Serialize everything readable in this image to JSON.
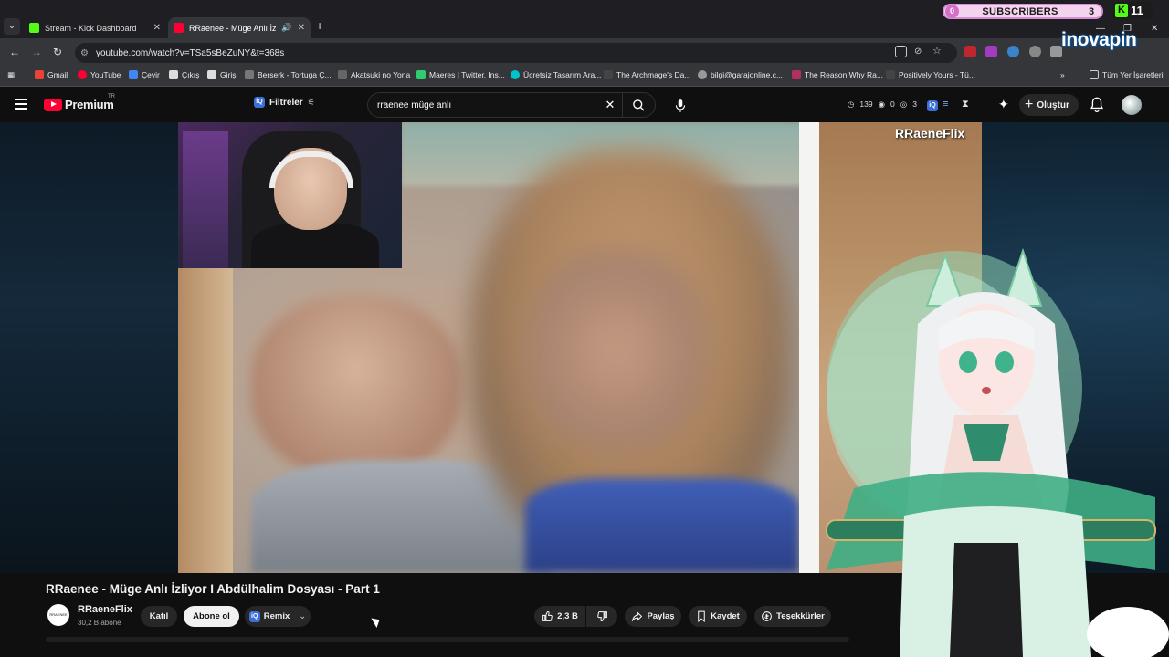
{
  "browser": {
    "tabs": [
      {
        "title": "Stream - Kick Dashboard",
        "active": false,
        "favicon_color": "#53fc18"
      },
      {
        "title": "RRaenee - Müge Anlı İzliyor",
        "active": true,
        "favicon_color": "#ff0033"
      }
    ],
    "url": "youtube.com/watch?v=TSa5sBeZuNY&t=368s",
    "bookmarks": [
      "Gmail",
      "YouTube",
      "Çevir",
      "Çıkış",
      "Giriş",
      "Berserk - Tortuga Ç...",
      "Akatsuki no Yona",
      "Maeres | Twitter, Ins...",
      "Ücretsiz Tasarım Ara...",
      "The Archmage's Da...",
      "bilgi@garajonline.c...",
      "The Reason Why Ra...",
      "Positively Yours - Tü..."
    ],
    "bookmarks_all": "Tüm Yer İşaretleri"
  },
  "overlay": {
    "subscribers_label": "SUBSCRIBERS",
    "subscribers_left": "0",
    "subscribers_count": "3",
    "kick_count": "11",
    "brand": "inovapin"
  },
  "youtube": {
    "logo_text": "Premium",
    "region": "TR",
    "filters_label": "Filtreler",
    "search_query": "rraenee müge anlı",
    "stats": {
      "views": "139",
      "a": "0",
      "b": "3"
    },
    "create_label": "Oluştur"
  },
  "video": {
    "watermark": "RRaeneFlix",
    "title": "RRaenee - Müge Anlı İzliyor I Abdülhalim Dosyası - Part 1",
    "channel": "RRaeneFlix",
    "subscribers": "30,2 B abone",
    "join_label": "Katıl",
    "subscribe_label": "Abone ol",
    "remix_label": "Remix",
    "likes": "2,3 B",
    "share_label": "Paylaş",
    "save_label": "Kaydet",
    "thanks_label": "Teşekkürler"
  }
}
